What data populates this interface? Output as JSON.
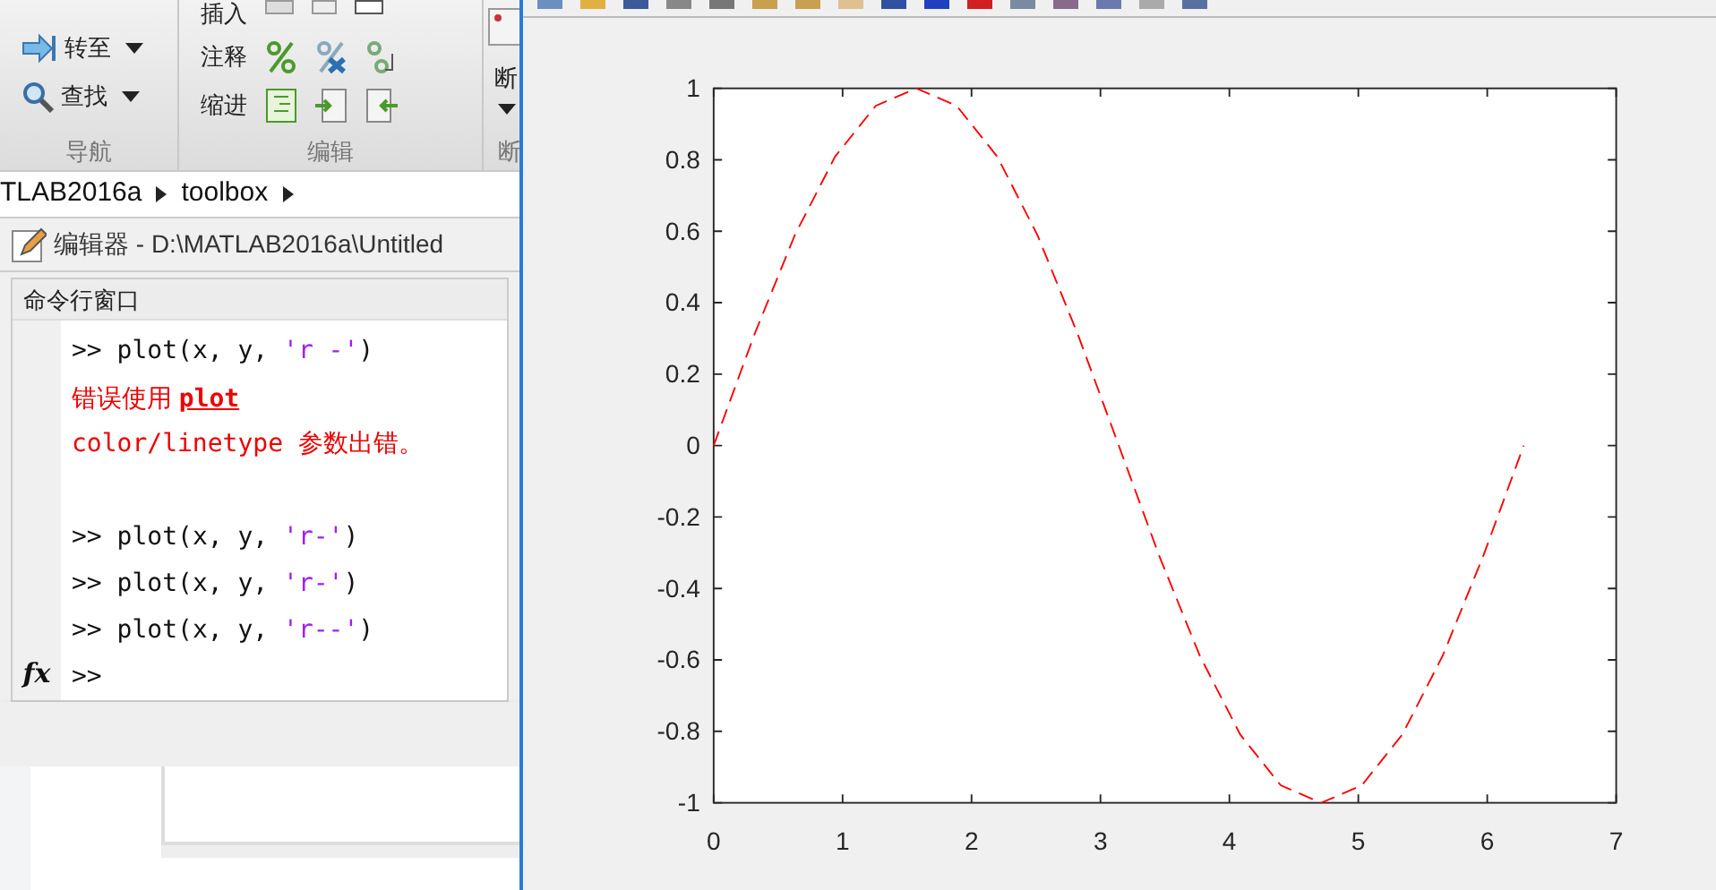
{
  "ribbon": {
    "groups": [
      {
        "label": "导航",
        "items": [
          {
            "kind": "nav",
            "label": "转至"
          },
          {
            "kind": "nav",
            "label": "查找"
          }
        ]
      },
      {
        "label": "编辑",
        "items": [
          {
            "kind": "edit",
            "label": "插入"
          },
          {
            "kind": "edit",
            "label": "注释"
          },
          {
            "kind": "edit",
            "label": "缩进"
          }
        ]
      },
      {
        "label": "断",
        "items": [
          {
            "kind": "big",
            "label": "断"
          }
        ]
      }
    ]
  },
  "breadcrumb": [
    "TLAB2016a",
    "toolbox"
  ],
  "editor": {
    "title": "编辑器 - D:\\MATLAB2016a\\Untitled"
  },
  "command_window": {
    "title": "命令行窗口",
    "lines": [
      {
        "kind": "command",
        "prompt": ">>",
        "code": "plot(x, y, ",
        "string": "'r -'",
        "close": ")"
      },
      {
        "kind": "error",
        "text": "错误使用",
        "link": "plot"
      },
      {
        "kind": "message",
        "text": "color/linetype 参数出错。"
      },
      {
        "kind": "blank"
      },
      {
        "kind": "command",
        "prompt": ">>",
        "code": "plot(x, y, ",
        "string": "'r-'",
        "close": ")"
      },
      {
        "kind": "command",
        "prompt": ">>",
        "code": "plot(x, y, ",
        "string": "'r-'",
        "close": ")"
      },
      {
        "kind": "command",
        "prompt": ">>",
        "code": "plot(x, y, ",
        "string": "'r--'",
        "close": ")"
      }
    ],
    "prompt_line": {
      "icon_text": "fx",
      "prompt": ">>"
    }
  },
  "figure": {
    "chart_data": {
      "type": "line",
      "x": [
        0,
        0.314,
        0.628,
        0.942,
        1.257,
        1.571,
        1.885,
        2.199,
        2.513,
        2.827,
        3.142,
        3.456,
        3.77,
        4.084,
        4.398,
        4.712,
        5.027,
        5.341,
        5.655,
        5.969,
        6.283
      ],
      "series": [
        {
          "color": "#ff0000",
          "line_style": "dashed",
          "values": [
            0,
            0.309,
            0.588,
            0.809,
            0.951,
            1,
            0.951,
            0.809,
            0.588,
            0.309,
            0,
            -0.309,
            -0.588,
            -0.809,
            -0.951,
            -1,
            -0.951,
            -0.809,
            -0.588,
            -0.309,
            0
          ]
        }
      ],
      "xlim": [
        0,
        7
      ],
      "ylim": [
        -1,
        1
      ],
      "xticks": [
        0,
        1,
        2,
        3,
        4,
        5,
        6,
        7
      ],
      "yticks": [
        {
          "value": -1,
          "label": "-1"
        },
        {
          "value": -0.8,
          "label": "-0.8"
        },
        {
          "value": -0.6,
          "label": "-0.6"
        },
        {
          "value": -0.4,
          "label": "-0.4"
        },
        {
          "value": -0.2,
          "label": "-0.2"
        },
        {
          "value": 0,
          "label": "0"
        },
        {
          "value": 0.2,
          "label": "0.2"
        },
        {
          "value": 0.4,
          "label": "0.4"
        },
        {
          "value": 0.6,
          "label": "0.6"
        },
        {
          "value": 0.8,
          "label": "0.8"
        },
        {
          "value": 1,
          "label": "1"
        }
      ]
    }
  }
}
